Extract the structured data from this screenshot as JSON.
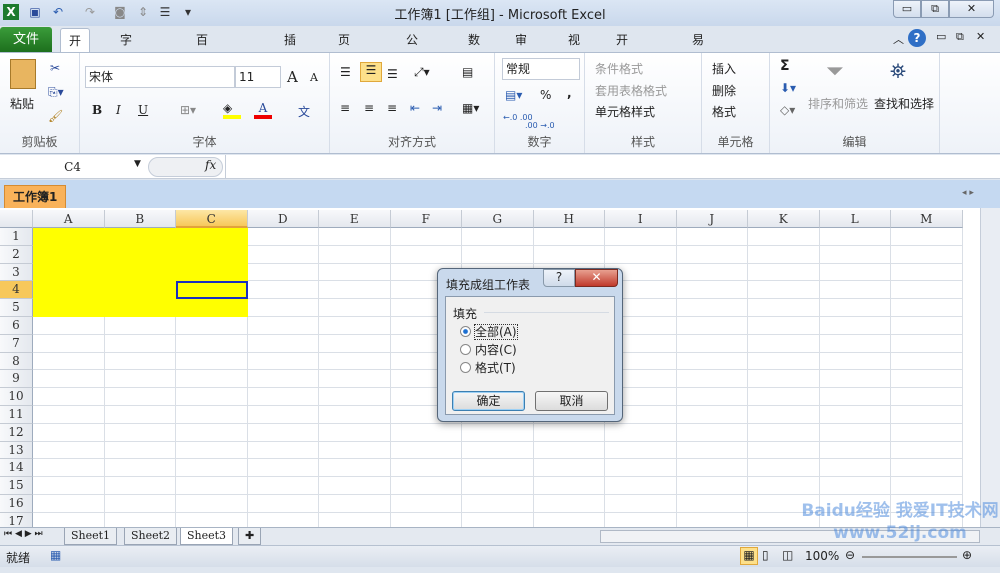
{
  "window": {
    "title": "工作簿1  [工作组] - Microsoft Excel",
    "minimize": "▭",
    "restore": "⧉",
    "close": "✕"
  },
  "quick_access": [
    "excel-logo-icon",
    "save-icon",
    "undo-icon",
    "redo-icon",
    "camera-icon",
    "sort-icon",
    "form-icon",
    "customize-icon"
  ],
  "tabs": {
    "file": "文件",
    "items": [
      "开始",
      "字符分离",
      "百宝箱ET版",
      "插入",
      "页面布局",
      "公式",
      "数据",
      "审阅",
      "视图",
      "开发工具",
      "易用宝"
    ]
  },
  "ribbon": {
    "clipboard": {
      "label": "剪贴板",
      "paste": "粘贴"
    },
    "font": {
      "label": "字体",
      "name": "宋体",
      "size": "11",
      "bold": "B",
      "italic": "I",
      "underline": "U",
      "grow": "A",
      "shrink": "A",
      "fill_color": "#ffff00",
      "font_color": "#ff0000",
      "phonetic": "文"
    },
    "alignment": {
      "label": "对齐方式"
    },
    "number": {
      "label": "数字",
      "format": "常规",
      "percent": "%",
      "comma": ",",
      "inc_decimal": "←.0 .00",
      "dec_decimal": ".00 →.0"
    },
    "styles": {
      "label": "样式",
      "conditional": "条件格式",
      "table": "套用表格格式",
      "cell_styles": "单元格样式"
    },
    "cells": {
      "label": "单元格",
      "insert": "插入",
      "delete": "删除",
      "format": "格式"
    },
    "editing": {
      "label": "编辑",
      "sum": "Σ",
      "sort_filter": "排序和筛选",
      "find_select": "查找和选择"
    }
  },
  "formula_bar": {
    "name_box": "C4",
    "fx": "fx",
    "value": ""
  },
  "workbook_tab": "工作簿1",
  "grid": {
    "columns": [
      "A",
      "B",
      "C",
      "D",
      "E",
      "F",
      "G",
      "H",
      "I",
      "J",
      "K",
      "L",
      "M"
    ],
    "rows": [
      "1",
      "2",
      "3",
      "4",
      "5",
      "6",
      "7",
      "8",
      "9",
      "10",
      "11",
      "12",
      "13",
      "14",
      "15",
      "16",
      "17"
    ],
    "selected_cell": "C4",
    "fill_color": "#ffff00",
    "filled_range": "A1:C5"
  },
  "sheets": [
    "Sheet1",
    "Sheet2",
    "Sheet3"
  ],
  "status": {
    "ready": "就绪",
    "zoom": "100%"
  },
  "dialog": {
    "title": "填充成组工作表",
    "help": "?",
    "close": "✕",
    "group": "填充",
    "options": [
      "全部(A)",
      "内容(C)",
      "格式(T)"
    ],
    "selected": 0,
    "ok": "确定",
    "cancel": "取消"
  },
  "watermark": "Baidu经验 我爱IT技术网 www.52ij.com"
}
